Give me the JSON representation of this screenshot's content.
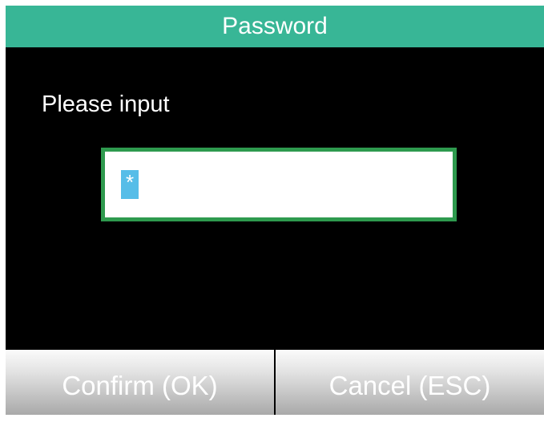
{
  "dialog": {
    "title": "Password",
    "prompt": "Please input",
    "password_value": "*",
    "colors": {
      "title_bar": "#38b696",
      "field_border": "#2e9a4e",
      "cursor_highlight": "#56bde8",
      "background": "#000000"
    }
  },
  "footer": {
    "confirm_label": "Confirm (OK)",
    "cancel_label": "Cancel (ESC)"
  }
}
